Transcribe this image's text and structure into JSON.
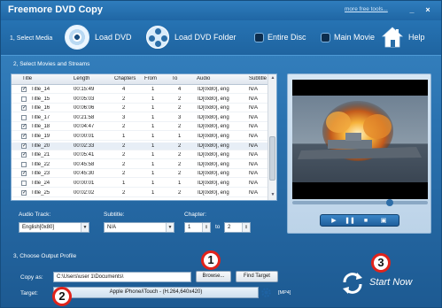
{
  "window": {
    "title": "Freemore DVD Copy",
    "more_tools": "more free tools...",
    "controls": {
      "minimize": "_",
      "close": "×"
    }
  },
  "toolbar": {
    "step": "1, Select Media",
    "load_dvd": "Load DVD",
    "load_dvd_folder": "Load DVD Folder",
    "entire_disc": "Entire Disc",
    "main_movie": "Main Movie",
    "help": "Help"
  },
  "section2": {
    "label": "2, Select Movies and Streams"
  },
  "table": {
    "columns": [
      "Title",
      "Length",
      "Chapters",
      "From",
      "To",
      "Audio",
      "Subtitle"
    ],
    "rows": [
      {
        "checked": true,
        "title": "Title_14",
        "length": "00:15:49",
        "chapters": "4",
        "from": "1",
        "to": "4",
        "audio": "ID[0x80], eng",
        "subtitle": "N/A"
      },
      {
        "checked": false,
        "title": "Title_15",
        "length": "00:05:03",
        "chapters": "2",
        "from": "1",
        "to": "2",
        "audio": "ID[0x80], eng",
        "subtitle": "N/A"
      },
      {
        "checked": true,
        "title": "Title_16",
        "length": "00:06:06",
        "chapters": "2",
        "from": "1",
        "to": "2",
        "audio": "ID[0x80], eng",
        "subtitle": "N/A"
      },
      {
        "checked": false,
        "title": "Title_17",
        "length": "00:21:58",
        "chapters": "3",
        "from": "1",
        "to": "3",
        "audio": "ID[0x80], eng",
        "subtitle": "N/A"
      },
      {
        "checked": true,
        "title": "Title_18",
        "length": "00:04:47",
        "chapters": "2",
        "from": "1",
        "to": "2",
        "audio": "ID[0x80], eng",
        "subtitle": "N/A"
      },
      {
        "checked": true,
        "title": "Title_19",
        "length": "00:00:01",
        "chapters": "1",
        "from": "1",
        "to": "1",
        "audio": "ID[0x80], eng",
        "subtitle": "N/A"
      },
      {
        "checked": true,
        "title": "Title_20",
        "length": "00:02:33",
        "chapters": "2",
        "from": "1",
        "to": "2",
        "audio": "ID[0x80], eng",
        "subtitle": "N/A"
      },
      {
        "checked": true,
        "title": "Title_21",
        "length": "00:05:41",
        "chapters": "2",
        "from": "1",
        "to": "2",
        "audio": "ID[0x80], eng",
        "subtitle": "N/A"
      },
      {
        "checked": false,
        "title": "Title_22",
        "length": "00:45:58",
        "chapters": "2",
        "from": "1",
        "to": "2",
        "audio": "ID[0x80], eng",
        "subtitle": "N/A"
      },
      {
        "checked": true,
        "title": "Title_23",
        "length": "00:45:30",
        "chapters": "2",
        "from": "1",
        "to": "2",
        "audio": "ID[0x80], eng",
        "subtitle": "N/A"
      },
      {
        "checked": false,
        "title": "Title_24",
        "length": "00:00:01",
        "chapters": "1",
        "from": "1",
        "to": "1",
        "audio": "ID[0x80], eng",
        "subtitle": "N/A"
      },
      {
        "checked": true,
        "title": "Title_25",
        "length": "00:02:02",
        "chapters": "2",
        "from": "1",
        "to": "2",
        "audio": "ID[0x80], eng",
        "subtitle": "N/A"
      }
    ]
  },
  "controls": {
    "audio_track_label": "Audio Track:",
    "audio_track_value": "English[0x80]",
    "subtitle_label": "Subtitle:",
    "subtitle_value": "N/A",
    "chapter_label": "Chapter:",
    "chapter_from": "1",
    "chapter_to_label": "to",
    "chapter_to": "2"
  },
  "player": {
    "progress": 0.72
  },
  "section3": {
    "label": "3, Choose Output Profile"
  },
  "output": {
    "copy_as_label": "Copy as:",
    "copy_as_value": "C:\\Users\\user 1\\Documents\\",
    "browse": "Browse...",
    "find_target": "Find Target",
    "target_label": "Target:",
    "target_value": "Apple iPhone/iTouch - (H.264,640x420)",
    "format_tag": "[MP4]"
  },
  "start": {
    "label": "Start Now"
  },
  "callouts": [
    "1",
    "2",
    "3"
  ]
}
